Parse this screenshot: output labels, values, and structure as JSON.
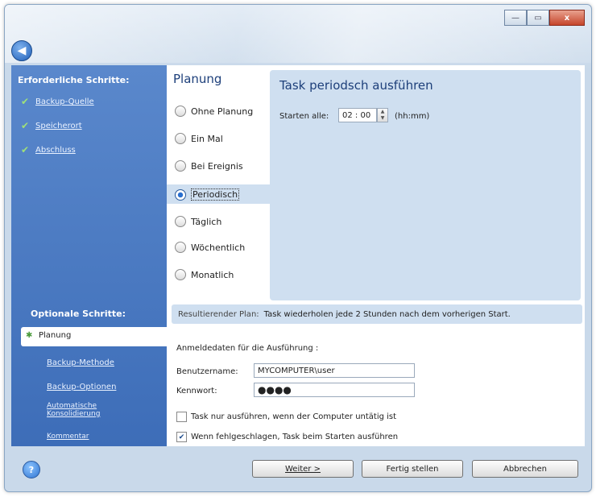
{
  "window": {
    "min": "—",
    "max": "▭",
    "close": "x"
  },
  "sidebar": {
    "required_title": "Erforderliche Schritte:",
    "required_items": [
      "Backup-Quelle",
      "Speicherort",
      "Abschluss"
    ],
    "optional_title": "Optionale Schritte:",
    "optional_selected": "Planung",
    "optional_items": [
      "Backup-Methode",
      "Backup-Optionen",
      "Automatische\nKonsolidierung",
      "Kommentar"
    ]
  },
  "planning": {
    "title": "Planung",
    "options": [
      "Ohne Planung",
      "Ein Mal",
      "Bei Ereignis",
      "Periodisch",
      "Täglich",
      "Wöchentlich",
      "Monatlich"
    ],
    "selected": "Periodisch"
  },
  "task": {
    "title": "Task periodsch ausführen",
    "start_label": "Starten alle:",
    "start_value": "02 : 00",
    "unit": "(hh:mm)"
  },
  "result": {
    "label": "Resultierender Plan:",
    "text": "Task wiederholen jede 2 Stunden nach dem vorherigen Start."
  },
  "credentials": {
    "title": "Anmeldedaten für die Ausführung :",
    "user_label": "Benutzername:",
    "user_value": "MYCOMPUTER\\user",
    "pass_label": "Kennwort:",
    "pass_value": "●●●●"
  },
  "checkboxes": [
    {
      "label": "Task nur ausführen, wenn der Computer untätig ist",
      "checked": false
    },
    {
      "label": "Wenn fehlgeschlagen, Task beim Starten ausführen",
      "checked": true
    }
  ],
  "buttons": {
    "next": "Weiter >",
    "finish": "Fertig stellen",
    "cancel": "Abbrechen"
  }
}
